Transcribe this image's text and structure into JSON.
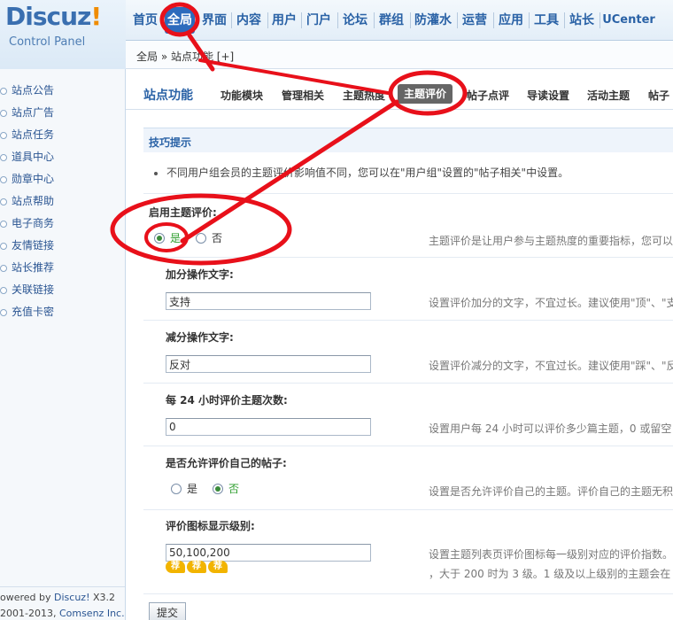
{
  "logo": {
    "brand": "Discuz",
    "exclaim": "!",
    "sub": "Control Panel"
  },
  "nav": {
    "items": [
      "首页",
      "全局",
      "界面",
      "内容",
      "用户",
      "门户",
      "论坛",
      "群组",
      "防灌水",
      "运营",
      "应用",
      "工具",
      "站长",
      "UCenter"
    ],
    "active": "全局"
  },
  "breadcrumb": {
    "text": "全局 » 站点功能  [+]"
  },
  "sidebar": {
    "items": [
      "站点公告",
      "站点广告",
      "站点任务",
      "道具中心",
      "勋章中心",
      "站点帮助",
      "电子商务",
      "友情链接",
      "站长推荐",
      "关联链接",
      "充值卡密"
    ]
  },
  "footer": {
    "powered_prefix": "owered by ",
    "powered_brand": "Discuz!",
    "version": " X3.2",
    "copyright_prefix": "2001-2013, ",
    "company": "Comsenz Inc."
  },
  "subnav": {
    "title": "站点功能",
    "tabs": [
      "功能模块",
      "管理相关",
      "主题热度",
      "主题评价",
      "帖子点评",
      "导读设置",
      "活动主题",
      "帖子"
    ],
    "active": "主题评价"
  },
  "tips": {
    "title": "技巧提示",
    "text": "不同用户组会员的主题评价影响值不同，您可以在\"用户组\"设置的\"帖子相关\"中设置。"
  },
  "form": {
    "enable": {
      "label": "启用主题评价:",
      "yes": "是",
      "no": "否",
      "desc": "主题评价是让用户参与主题热度的重要指标，您可以"
    },
    "plus": {
      "label": "加分操作文字:",
      "value": "支持",
      "desc": "设置评价加分的文字，不宜过长。建议使用\"顶\"、\"支"
    },
    "minus": {
      "label": "减分操作文字:",
      "value": "反对",
      "desc": "设置评价减分的文字，不宜过长。建议使用\"踩\"、\"反"
    },
    "per24": {
      "label": "每 24 小时评价主题次数:",
      "value": "0",
      "desc": "设置用户每 24 小时可以评价多少篇主题，0 或留空"
    },
    "self": {
      "label": "是否允许评价自己的帖子:",
      "yes": "是",
      "no": "否",
      "desc": "设置是否允许评价自己的主题。评价自己的主题无积"
    },
    "levels": {
      "label": "评价图标显示级别:",
      "value": "50,100,200",
      "desc": "设置主题列表页评价图标每一级别对应的评价指数。",
      "desc2": "，大于 200 时为 3 级。1 级及以上级别的主题会在",
      "star_text": "荐"
    },
    "submit": "提交"
  },
  "colors": {
    "annotation": "#e8101a",
    "accent": "#2a62a6",
    "active_tab": "#666666"
  }
}
